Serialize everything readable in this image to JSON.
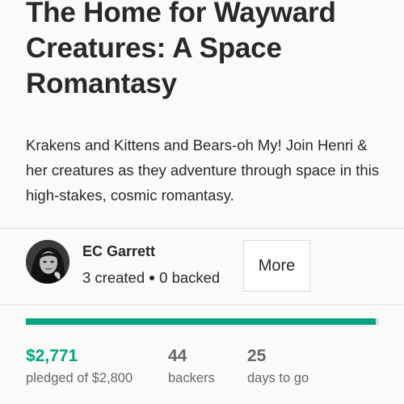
{
  "project": {
    "title": "The Home for Wayward Creatures: A Space Romantasy",
    "blurb": "Krakens and Kittens and Bears-oh My! Join Henri & her creatures as they adventure through space in this high-stakes, cosmic romantasy."
  },
  "creator": {
    "name": "EC Garrett",
    "created": "3 created",
    "backed": "0 backed",
    "more_label": "More"
  },
  "funding": {
    "progress_fraction": 0.99,
    "pledged_amount": "$2,771",
    "pledged_label": "pledged of $2,800",
    "backers_count": "44",
    "backers_label": "backers",
    "days_count": "25",
    "days_label": "days to go"
  },
  "colors": {
    "accent": "#05a47e",
    "text": "#282828",
    "muted": "#656969",
    "track": "#dcdedd"
  }
}
